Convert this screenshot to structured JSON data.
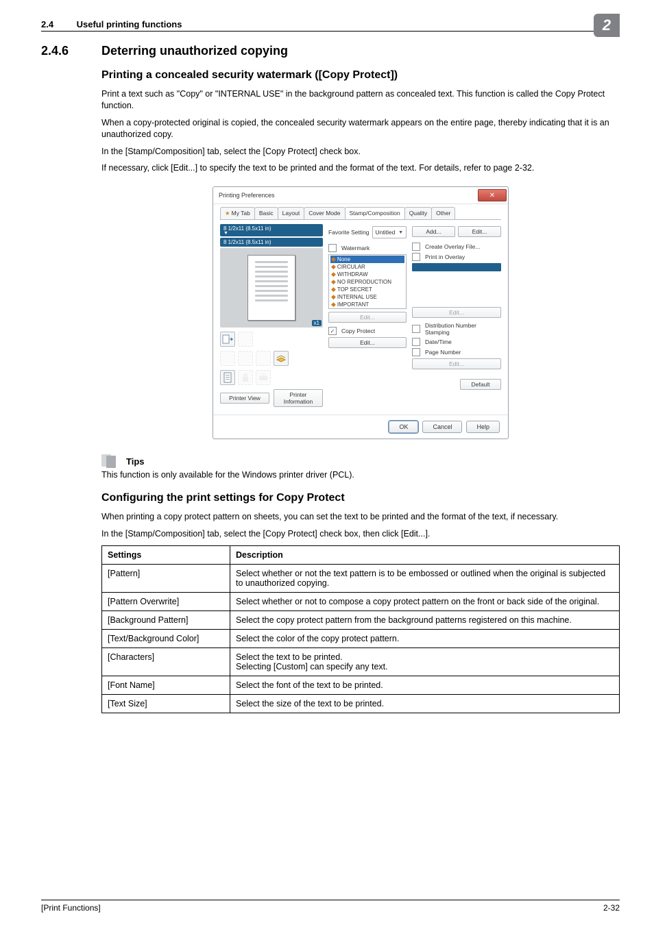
{
  "header": {
    "section_number": "2.4",
    "title": "Useful printing functions",
    "chip": "2"
  },
  "h2": {
    "number": "2.4.6",
    "title": "Deterring unauthorized copying"
  },
  "section1": {
    "heading": "Printing a concealed security watermark ([Copy Protect])",
    "p1": "Print a text such as \"Copy\" or \"INTERNAL USE\" in the background pattern as concealed text. This function is called the Copy Protect function.",
    "p2": "When a copy-protected original is copied, the concealed security watermark appears on the entire page, thereby indicating that it is an unauthorized copy.",
    "p3": "In the [Stamp/Composition] tab, select the [Copy Protect] check box.",
    "p4": "If necessary, click [Edit...] to specify the text to be printed and the format of the text. For details, refer to page 2-32."
  },
  "dialog": {
    "title": "Printing Preferences",
    "tabs": {
      "mytab": "My Tab",
      "basic": "Basic",
      "layout": "Layout",
      "cover": "Cover Mode",
      "stamp": "Stamp/Composition",
      "quality": "Quality",
      "other": "Other"
    },
    "size1": "8 1/2x11 (8.5x11 in)",
    "size2": "8 1/2x11 (8.5x11 in)",
    "x1": "x1",
    "fav_label": "Favorite Setting",
    "fav_value": "Untitled",
    "add": "Add...",
    "edit": "Edit...",
    "watermark_label": "Watermark",
    "watermark_items": {
      "i0": "None",
      "i1": "CIRCULAR",
      "i2": "WITHDRAW",
      "i3": "NO REPRODUCTION",
      "i4": "TOP SECRET",
      "i5": "INTERNAL USE",
      "i6": "IMPORTANT"
    },
    "wm_edit": "Edit...",
    "copy_protect": "Copy Protect",
    "cp_edit": "Edit...",
    "create_overlay": "Create Overlay File...",
    "print_overlay": "Print in Overlay",
    "ov_edit": "Edit...",
    "dist_stamp": "Distribution Number Stamping",
    "date_time": "Date/Time",
    "page_num": "Page Number",
    "dn_edit": "Edit...",
    "printer_view": "Printer View",
    "printer_info": "Printer Information",
    "default": "Default",
    "ok": "OK",
    "cancel": "Cancel",
    "help": "Help"
  },
  "tips": {
    "label": "Tips",
    "text": "This function is only available for the Windows printer driver (PCL)."
  },
  "section2": {
    "heading": "Configuring the print settings for Copy Protect",
    "p1": "When printing a copy protect pattern on sheets, you can set the text to be printed and the format of the text, if necessary.",
    "p2": "In the [Stamp/Composition] tab, select the [Copy Protect] check box, then click [Edit...]."
  },
  "table": {
    "head": {
      "c1": "Settings",
      "c2": "Description"
    },
    "rows": {
      "r1": {
        "k": "[Pattern]",
        "v": "Select whether or not the text pattern is to be embossed or outlined when the original is subjected to unauthorized copying."
      },
      "r2": {
        "k": "[Pattern Overwrite]",
        "v": "Select whether or not to compose a copy protect pattern on the front or back side of the original."
      },
      "r3": {
        "k": "[Background Pattern]",
        "v": "Select the copy protect pattern from the background patterns registered on this machine."
      },
      "r4": {
        "k": "[Text/Background Color]",
        "v": "Select the color of the copy protect pattern."
      },
      "r5": {
        "k": "[Characters]",
        "v": "Select the text to be printed.\nSelecting [Custom] can specify any text."
      },
      "r6": {
        "k": "[Font Name]",
        "v": "Select the font of the text to be printed."
      },
      "r7": {
        "k": "[Text Size]",
        "v": "Select the size of the text to be printed."
      }
    }
  },
  "footer": {
    "left": "[Print Functions]",
    "right": "2-32"
  }
}
